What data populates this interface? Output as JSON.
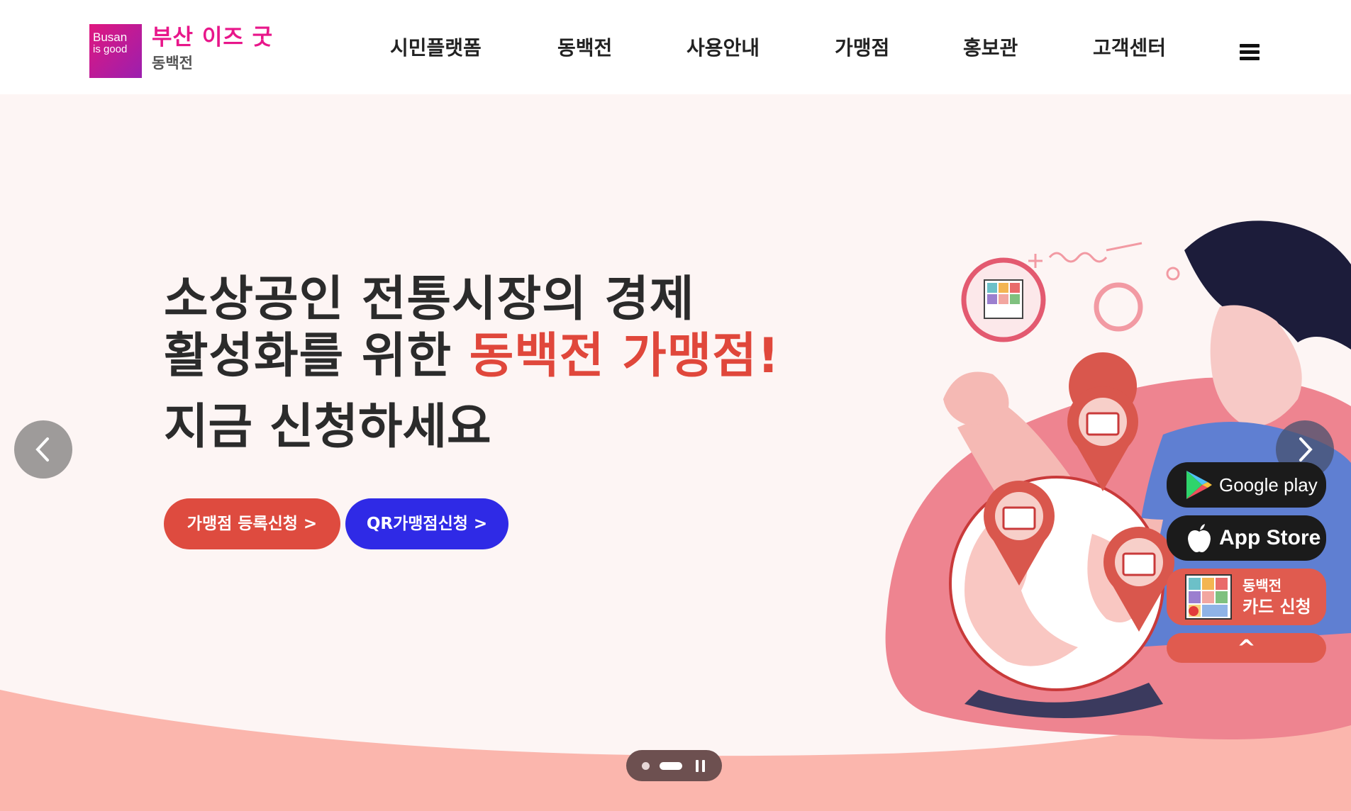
{
  "header": {
    "logo_line1": "Busan",
    "logo_line2": "is good",
    "logo_title": "부산 이즈 굿",
    "logo_sub": "동백전",
    "nav": [
      "시민플랫폼",
      "동백전",
      "사용안내",
      "가맹점",
      "홍보관",
      "고객센터"
    ]
  },
  "hero": {
    "headline_line1": "소상공인 전통시장의 경제",
    "headline_line2a": "활성화를 위한 ",
    "headline_line2b": "동백전 가맹점!",
    "headline_line3": "지금 신청하세요",
    "btn_register": "가맹점 등록신청 >",
    "btn_qr": "QR가맹점신청 >"
  },
  "quick": {
    "google": "Google play",
    "apple": "App Store",
    "card_line1": "동백전",
    "card_line2": "카드 신청",
    "top": "^"
  },
  "colors": {
    "brand_pink": "#e8168a",
    "accent_red": "#e0473b",
    "accent_blue": "#2f2ae6",
    "hero_bg": "#fdf5f4"
  }
}
